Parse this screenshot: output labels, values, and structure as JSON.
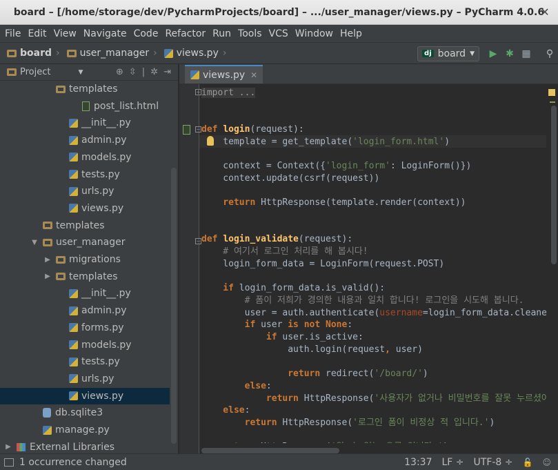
{
  "window": {
    "title": "board – [/home/storage/dev/PycharmProjects/board] – .../user_manager/views.py – PyCharm 4.0.6",
    "close": "✕"
  },
  "menu": [
    "File",
    "Edit",
    "View",
    "Navigate",
    "Code",
    "Refactor",
    "Run",
    "Tools",
    "VCS",
    "Window",
    "Help"
  ],
  "breadcrumbs": [
    {
      "label": "board",
      "icon": "folder-icon"
    },
    {
      "label": "user_manager",
      "icon": "folder-icon"
    },
    {
      "label": "views.py",
      "icon": "python-file-icon"
    }
  ],
  "run_config": {
    "badge": "dj",
    "label": "board"
  },
  "sidebar": {
    "title": "Project",
    "tree": [
      {
        "label": "templates",
        "indent": 3,
        "icon": "folder"
      },
      {
        "label": "post_list.html",
        "indent": 5,
        "icon": "html"
      },
      {
        "label": "__init__.py",
        "indent": 4,
        "icon": "py"
      },
      {
        "label": "admin.py",
        "indent": 4,
        "icon": "py"
      },
      {
        "label": "models.py",
        "indent": 4,
        "icon": "py"
      },
      {
        "label": "tests.py",
        "indent": 4,
        "icon": "py"
      },
      {
        "label": "urls.py",
        "indent": 4,
        "icon": "py"
      },
      {
        "label": "views.py",
        "indent": 4,
        "icon": "py"
      },
      {
        "label": "templates",
        "indent": 2,
        "icon": "folder"
      },
      {
        "label": "user_manager",
        "indent": 2,
        "icon": "folder",
        "arrow": "▼"
      },
      {
        "label": "migrations",
        "indent": 3,
        "icon": "folder",
        "arrow": "▶"
      },
      {
        "label": "templates",
        "indent": 3,
        "icon": "folder",
        "arrow": "▶"
      },
      {
        "label": "__init__.py",
        "indent": 4,
        "icon": "py"
      },
      {
        "label": "admin.py",
        "indent": 4,
        "icon": "py"
      },
      {
        "label": "forms.py",
        "indent": 4,
        "icon": "py"
      },
      {
        "label": "models.py",
        "indent": 4,
        "icon": "py"
      },
      {
        "label": "tests.py",
        "indent": 4,
        "icon": "py"
      },
      {
        "label": "urls.py",
        "indent": 4,
        "icon": "py"
      },
      {
        "label": "views.py",
        "indent": 4,
        "icon": "py",
        "selected": true
      },
      {
        "label": "db.sqlite3",
        "indent": 2,
        "icon": "db"
      },
      {
        "label": "manage.py",
        "indent": 2,
        "icon": "py"
      },
      {
        "label": "External Libraries",
        "indent": 0,
        "icon": "lib",
        "arrow": "▶"
      }
    ]
  },
  "editor": {
    "tab": "views.py",
    "code_lines": [
      [
        [
          "fold",
          "import ..."
        ]
      ],
      [],
      [],
      [
        [
          "kw",
          "def "
        ],
        [
          "fn",
          "login"
        ],
        [
          "",
          "(request):"
        ]
      ],
      [
        [
          "",
          "    template = get_template("
        ],
        [
          "str",
          "'login_form.html'"
        ],
        [
          "",
          ")"
        ]
      ],
      [],
      [
        [
          "",
          "    context = Context({"
        ],
        [
          "str",
          "'login_form'"
        ],
        [
          "",
          ": LoginForm()})"
        ]
      ],
      [
        [
          "",
          "    context.update(csrf(request))"
        ]
      ],
      [],
      [
        [
          "kw",
          "    return "
        ],
        [
          "",
          "HttpResponse(template.render(context))"
        ]
      ],
      [],
      [],
      [
        [
          "kw",
          "def "
        ],
        [
          "fn",
          "login_validate"
        ],
        [
          "",
          "(request):"
        ]
      ],
      [
        [
          "cm",
          "    # 여기서 로그인 처리를 해 봅시다!"
        ]
      ],
      [
        [
          "",
          "    login_form_data = LoginForm(request.POST)"
        ]
      ],
      [],
      [
        [
          "kw",
          "    if "
        ],
        [
          "",
          "login_form_data.is_valid():"
        ]
      ],
      [
        [
          "cm",
          "        # 폼이 저희가 경의한 내용과 일치 합니다! 로그인을 시도해 봅니다."
        ]
      ],
      [
        [
          "",
          "        user = auth.authenticate("
        ],
        [
          "named",
          "username"
        ],
        [
          "",
          "=login_form_data.cleaned_data["
        ]
      ],
      [
        [
          "kw",
          "        if "
        ],
        [
          "",
          "user "
        ],
        [
          "kw",
          "is not None"
        ],
        [
          "",
          ":"
        ]
      ],
      [
        [
          "kw",
          "            if "
        ],
        [
          "",
          "user.is_active:"
        ]
      ],
      [
        [
          "",
          "                auth.login(request"
        ],
        [
          "kw",
          ", "
        ],
        [
          "",
          "user)"
        ]
      ],
      [],
      [
        [
          "kw",
          "                return "
        ],
        [
          "",
          "redirect("
        ],
        [
          "str",
          "'/board/'"
        ],
        [
          "",
          ")"
        ]
      ],
      [
        [
          "kw",
          "        else"
        ],
        [
          "",
          ":"
        ]
      ],
      [
        [
          "kw",
          "            return "
        ],
        [
          "",
          "HttpResponse("
        ],
        [
          "str",
          "'사용자가 없거나 비밀번호를 잘못 누르셨어요'"
        ],
        [
          "",
          ")"
        ]
      ],
      [
        [
          "kw",
          "    else"
        ],
        [
          "",
          ":"
        ]
      ],
      [
        [
          "kw",
          "        return "
        ],
        [
          "",
          "HttpResponse("
        ],
        [
          "str",
          "'로그인 폼이 비정상 적 입니다.'"
        ],
        [
          "",
          ")"
        ]
      ],
      [],
      [
        [
          "kw",
          "    return "
        ],
        [
          "",
          "HttpResponse("
        ],
        [
          "str",
          "'알 수 없는 오류 입니다.'"
        ],
        [
          "",
          ")"
        ]
      ]
    ]
  },
  "status": {
    "message": "1 occurrence changed",
    "position": "13:37",
    "line_sep": "LF ÷",
    "encoding": "UTF-8 ÷"
  }
}
